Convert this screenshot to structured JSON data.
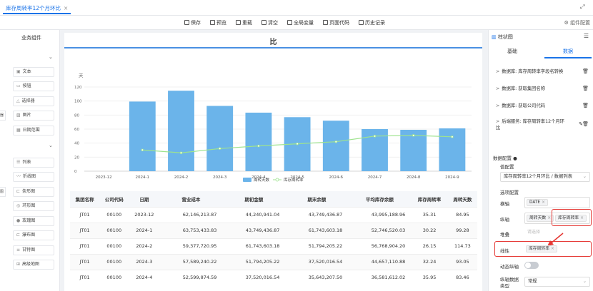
{
  "tab": {
    "title": "库存周转率12个月环比",
    "close": "×"
  },
  "toolbar": {
    "save": "保存",
    "preview": "预览",
    "redo": "重载",
    "clear": "清空",
    "global_vars": "全局变量",
    "page_code": "页面代码",
    "history": "历史记录",
    "component_config": "组件配置"
  },
  "left": {
    "title": "业务组件",
    "items": [
      "文本",
      "按钮",
      "选择器",
      "图片",
      "日期范围",
      "列表",
      "折线图",
      "条形图",
      "环形图",
      "玫瑰图",
      "瀑布图",
      "甘特图",
      "高级地图"
    ],
    "left_stubs": [
      "器",
      "图"
    ]
  },
  "chart": {
    "title": "比",
    "unit": "天",
    "legend_bar": "周转天数",
    "legend_line": "库存周转率"
  },
  "chart_data": {
    "type": "bar",
    "categories": [
      "2023-12",
      "2024-1",
      "2024-2",
      "2024-3",
      "2024-4",
      "2024-5",
      "2024-6",
      "2024-7",
      "2024-8",
      "2024-9"
    ],
    "series": [
      {
        "name": "周转天数",
        "type": "bar",
        "values": [
          0,
          99.28,
          114.73,
          93.05,
          83.46,
          77,
          72,
          60,
          59,
          61
        ]
      },
      {
        "name": "库存周转率",
        "type": "line",
        "values": [
          null,
          30.22,
          26.15,
          32.24,
          35.95,
          39,
          42,
          50,
          51,
          49
        ]
      }
    ],
    "ylabel": "天",
    "yticks": [
      0,
      20,
      40,
      60,
      80,
      100,
      120
    ],
    "ylim": [
      0,
      120
    ],
    "colors": {
      "bar": "#6bb4ea",
      "line": "#9ee38e"
    },
    "legend": "bottom"
  },
  "table": {
    "headers": [
      "集团名称",
      "公司代码",
      "日期",
      "营业成本",
      "期初金额",
      "期末余额",
      "平均库存余额",
      "库存周转率",
      "周转天数"
    ],
    "rows": [
      [
        "JT01",
        "00100",
        "2023-12",
        "62,146,213.87",
        "44,240,941.04",
        "43,749,436.87",
        "43,995,188.96",
        "35.31",
        "84.95"
      ],
      [
        "JT01",
        "00100",
        "2024-1",
        "63,753,433.83",
        "43,749,436.87",
        "61,743,603.18",
        "52,746,520.03",
        "30.22",
        "99.28"
      ],
      [
        "JT01",
        "00100",
        "2024-2",
        "59,377,720.95",
        "61,743,603.18",
        "51,794,205.22",
        "56,768,904.20",
        "26.15",
        "114.73"
      ],
      [
        "JT01",
        "00100",
        "2024-3",
        "57,589,240.22",
        "51,794,205.22",
        "37,520,016.54",
        "44,657,110.88",
        "32.24",
        "93.05"
      ],
      [
        "JT01",
        "00100",
        "2024-4",
        "52,599,874.59",
        "37,520,016.54",
        "35,643,207.50",
        "36,581,612.02",
        "35.95",
        "83.46"
      ]
    ]
  },
  "right": {
    "head": "柱状图",
    "tabs": {
      "basic": "基础",
      "data": "数据"
    },
    "datasources": [
      "数据库: 库存周转率字段名转换",
      "数据库: 获取集团名称",
      "数据库: 获取公司代码",
      "后端服务: 库存周转率12个月环比"
    ],
    "data_config": "数据配置",
    "value_config": "值配置",
    "value_select": "库存周转率12个月环比 / 数据列表",
    "option_config": "选项配置",
    "x_axis_label": "横轴",
    "x_axis_chips": [
      "DATE"
    ],
    "y_axis_label": "纵轴",
    "y_axis_chips": [
      "周转天数",
      "库存周转率"
    ],
    "stack_label": "堆叠",
    "stack_placeholder": "请选择",
    "line_label": "线性",
    "line_chips": [
      "库存周转率"
    ],
    "dynamic_label": "动态纵轴",
    "ytype_label": "纵轴数据类型",
    "ytype_value": "常规"
  }
}
